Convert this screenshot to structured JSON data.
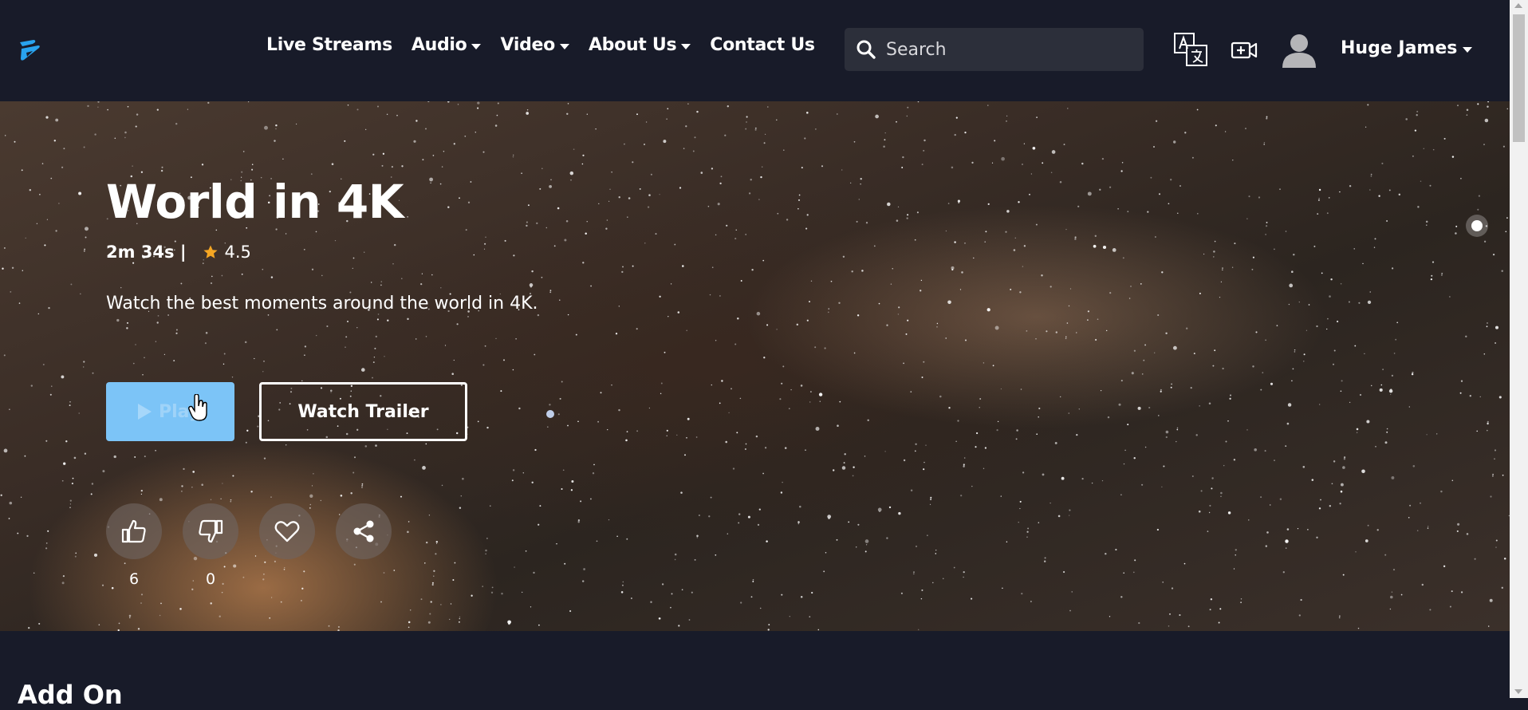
{
  "header": {
    "logo_icon": "streaming-logo-icon",
    "nav": [
      {
        "label": "Live Streams",
        "dropdown": false
      },
      {
        "label": "Audio",
        "dropdown": true
      },
      {
        "label": "Video",
        "dropdown": true
      },
      {
        "label": "About Us",
        "dropdown": true
      },
      {
        "label": "Contact Us",
        "dropdown": false
      }
    ],
    "search": {
      "placeholder": "Search",
      "value": ""
    },
    "icons": [
      "translate-icon",
      "add-video-icon",
      "avatar-icon"
    ],
    "user": {
      "name": "Huge James"
    }
  },
  "hero": {
    "title": "World in 4K",
    "duration": "2m 34s |",
    "rating": "4.5",
    "description": "Watch the best moments around the world in 4K.",
    "play_label": "Play",
    "trailer_label": "Watch Trailer",
    "actions": [
      {
        "icon": "thumbs-up-icon",
        "count": "6"
      },
      {
        "icon": "thumbs-down-icon",
        "count": "0"
      },
      {
        "icon": "heart-icon",
        "count": ""
      },
      {
        "icon": "share-icon",
        "count": ""
      }
    ]
  },
  "section": {
    "title": "Add On"
  },
  "colors": {
    "background": "#181b29",
    "accent": "#2fa8f0",
    "play_button": "#7cc4f7",
    "star": "#f5a623"
  }
}
